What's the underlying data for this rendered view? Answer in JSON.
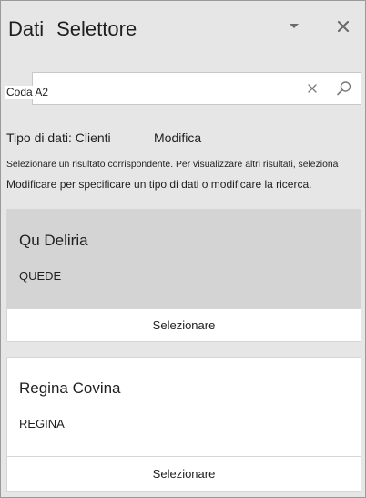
{
  "header": {
    "title_part1": "Dati",
    "title_part2": "Selettore",
    "options_icon": "chevron-down-icon",
    "close_icon": "close-icon"
  },
  "search": {
    "value": "Coda A2",
    "placeholder": "",
    "clear_icon": "close-icon",
    "search_icon": "search-icon"
  },
  "data_type": {
    "label": "Tipo di dati: Clienti",
    "modify_link": "Modifica"
  },
  "hints": {
    "line1": "Selezionare un risultato corrispondente. Per visualizzare altri risultati, seleziona",
    "line2": "Modificare per specificare un tipo di dati o modificare la ricerca."
  },
  "results": [
    {
      "name": "Qu Deliria",
      "code": "QUEDE",
      "select_label": "Selezionare",
      "highlighted": true
    },
    {
      "name": "Regina Covina",
      "code": "REGINA",
      "select_label": "Selezionare",
      "highlighted": false
    }
  ],
  "colors": {
    "pane_background": "#e6e6e6",
    "card_highlight": "#d4d4d4",
    "card_background": "#ffffff",
    "text": "#1f1f1f",
    "icon": "#6b6b6b"
  }
}
